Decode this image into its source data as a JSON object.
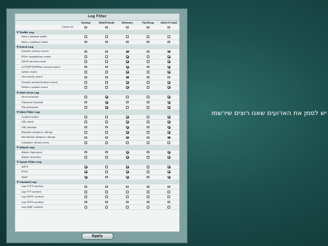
{
  "panel": {
    "title": "Log Filter",
    "apply_label": "Apply"
  },
  "columns": [
    "",
    "Syslog",
    "WebTrends",
    "Memory",
    "FortiLog",
    "Alert E-mail"
  ],
  "check_all_label": "Check All",
  "sections": [
    {
      "name": "Traffic Log",
      "items": [
        {
          "label": "Policy allowed traffic",
          "checks": [
            false,
            false,
            false,
            false,
            false
          ]
        },
        {
          "label": "Policy violation traffic",
          "checks": [
            false,
            false,
            false,
            false,
            false
          ]
        }
      ]
    },
    {
      "name": "Event Log",
      "items": [
        {
          "label": "System activity event",
          "checks": [
            false,
            false,
            true,
            false,
            true
          ]
        },
        {
          "label": "IPSec negotiation event",
          "checks": [
            false,
            false,
            true,
            false,
            true
          ]
        },
        {
          "label": "DHCP service event",
          "checks": [
            false,
            false,
            true,
            false,
            true
          ]
        },
        {
          "label": "L2TP/PPTP/PPPoE service event",
          "checks": [
            false,
            false,
            true,
            false,
            true
          ]
        },
        {
          "label": "Admin event",
          "checks": [
            false,
            false,
            true,
            false,
            true
          ]
        },
        {
          "label": "HA activity event",
          "checks": [
            false,
            false,
            true,
            false,
            false
          ]
        },
        {
          "label": "Firewall authentication event",
          "checks": [
            false,
            false,
            true,
            false,
            true
          ]
        },
        {
          "label": "Pattern update event",
          "checks": [
            false,
            false,
            true,
            false,
            true
          ]
        }
      ]
    },
    {
      "name": "Anti-virus Log",
      "items": [
        {
          "label": "Virus infected",
          "checks": [
            false,
            true,
            false,
            false,
            true
          ]
        },
        {
          "label": "Filename blocked",
          "checks": [
            false,
            true,
            false,
            false,
            true
          ]
        },
        {
          "label": "File oversized",
          "checks": [
            false,
            true,
            false,
            false,
            true
          ]
        }
      ]
    },
    {
      "name": "Web Filter Log",
      "items": [
        {
          "label": "Content block",
          "checks": [
            false,
            false,
            true,
            false,
            true
          ]
        },
        {
          "label": "URL block",
          "checks": [
            false,
            false,
            true,
            false,
            true
          ]
        },
        {
          "label": "URL exempt",
          "checks": [
            false,
            false,
            true,
            false,
            true
          ]
        },
        {
          "label": "Blocked category ratings",
          "checks": [
            false,
            false,
            true,
            false,
            true
          ]
        },
        {
          "label": "Monitored category ratings",
          "checks": [
            false,
            false,
            true,
            false,
            true
          ]
        },
        {
          "label": "Category rating errors",
          "checks": [
            false,
            false,
            false,
            false,
            false
          ]
        }
      ]
    },
    {
      "name": "Attack Log",
      "items": [
        {
          "label": "Attack Signature",
          "checks": [
            false,
            false,
            true,
            false,
            true
          ]
        },
        {
          "label": "Attack Anomaly",
          "checks": [
            false,
            false,
            true,
            false,
            true
          ]
        }
      ]
    },
    {
      "name": "Spam Filter Log",
      "items": [
        {
          "label": "SMTP",
          "checks": [
            true,
            false,
            true,
            false,
            true
          ]
        },
        {
          "label": "POP3",
          "checks": [
            true,
            false,
            true,
            false,
            true
          ]
        },
        {
          "label": "IMAP",
          "checks": [
            true,
            false,
            true,
            false,
            true
          ]
        }
      ]
    },
    {
      "name": "Content Log",
      "items": [
        {
          "label": "Log HTTP content",
          "checks": [
            false,
            false,
            false,
            false,
            false
          ]
        },
        {
          "label": "Log FTP content",
          "checks": [
            false,
            false,
            false,
            false,
            false
          ]
        },
        {
          "label": "Log SMTP content",
          "checks": [
            false,
            false,
            false,
            false,
            false
          ]
        },
        {
          "label": "Log POP3 content",
          "checks": [
            false,
            false,
            false,
            false,
            false
          ]
        },
        {
          "label": "Log IMAP content",
          "checks": [
            false,
            false,
            false,
            false,
            false
          ]
        }
      ]
    }
  ],
  "caption": "יש לסמן את הארועים שאנו רוצים שירשמו",
  "colors": {
    "background": "#1c4f4d",
    "panel": "#7fa2a1",
    "section_row": "#d5e1e1"
  }
}
